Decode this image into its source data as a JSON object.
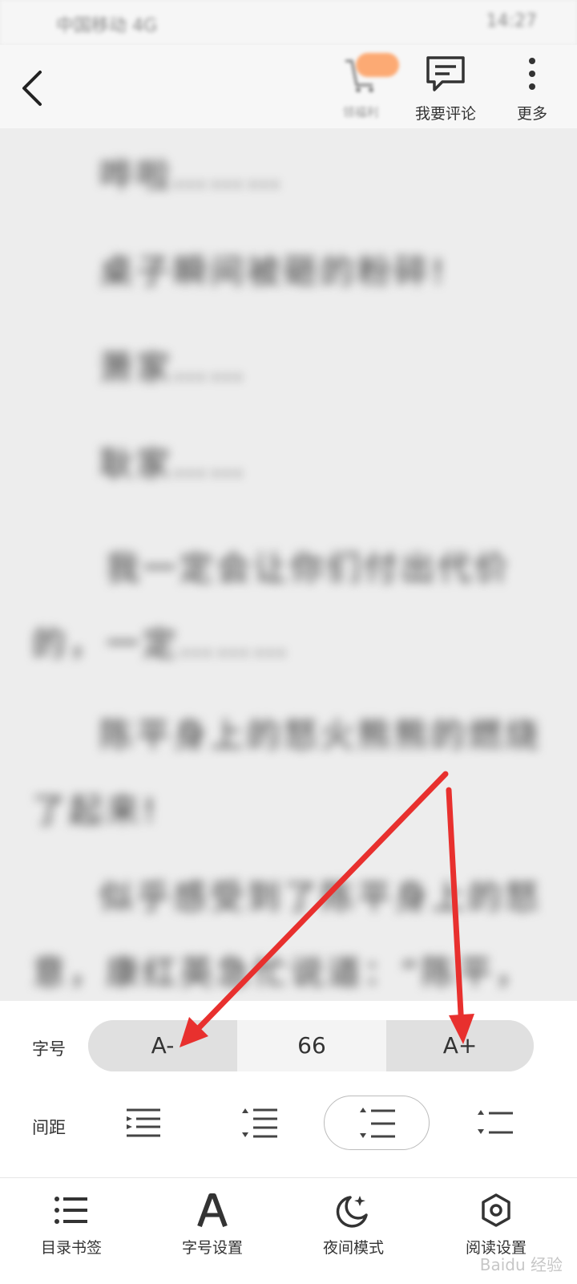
{
  "statusbar": {
    "left": "中国移动 4G",
    "right": "14:27"
  },
  "topbar": {
    "gift_label": "领福利",
    "comment_label": "我要评论",
    "more_label": "更多"
  },
  "content": {
    "paragraphs": [
      "哗啦………",
      "桌子瞬间被砸的粉碎!",
      "萧家……",
      "耿家……",
      "我一定会让你们付出代价的，一定………",
      "陈平身上的怒火熊熊的燃烧了起来!",
      "似乎感受到了陈平身上的怒意，康红英急忙说道：“陈平，"
    ]
  },
  "settings": {
    "font_size_label": "字号",
    "font_decrease": "A-",
    "font_size_value": "66",
    "font_increase": "A+",
    "spacing_label": "间距",
    "spacing_selected_index": 2
  },
  "tabs": [
    {
      "label": "目录书签",
      "icon": "list-icon"
    },
    {
      "label": "字号设置",
      "icon": "font-a-icon"
    },
    {
      "label": "夜间模式",
      "icon": "moon-icon"
    },
    {
      "label": "阅读设置",
      "icon": "settings-hex-icon"
    }
  ],
  "watermark": "Baidu 经验",
  "colors": {
    "arrow": "#e8302e",
    "badge": "#ff8a3d"
  }
}
